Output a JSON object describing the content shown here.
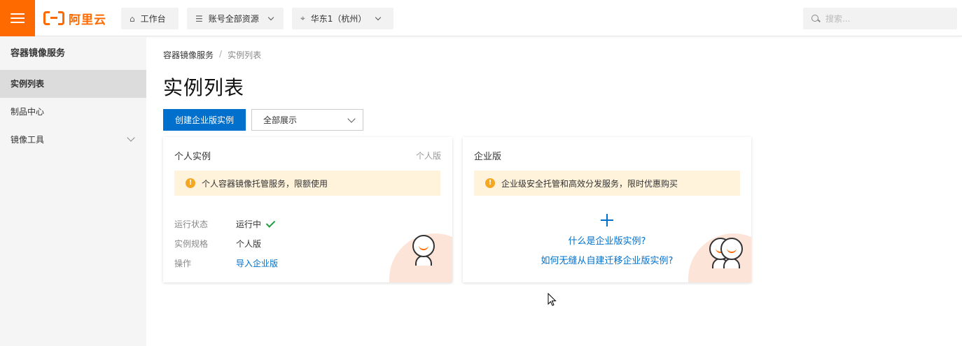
{
  "topbar": {
    "logo_text": "阿里云",
    "workbench_label": "工作台",
    "resources_label": "账号全部资源",
    "region_label": "华东1（杭州）",
    "search_placeholder": "搜索..."
  },
  "sidebar": {
    "title": "容器镜像服务",
    "items": [
      {
        "label": "实例列表",
        "active": true
      },
      {
        "label": "制品中心",
        "active": false
      },
      {
        "label": "镜像工具",
        "active": false
      }
    ]
  },
  "breadcrumb": {
    "root": "容器镜像服务",
    "separator": "/",
    "current": "实例列表"
  },
  "page": {
    "title": "实例列表",
    "create_button": "创建企业版实例",
    "filter_value": "全部展示"
  },
  "personal_card": {
    "title": "个人实例",
    "tag": "个人版",
    "notice": "个人容器镜像托管服务，限额使用",
    "rows": [
      {
        "key": "运行状态",
        "value": "运行中"
      },
      {
        "key": "实例规格",
        "value": "个人版"
      },
      {
        "key": "操作",
        "value": "导入企业版"
      }
    ]
  },
  "enterprise_card": {
    "title": "企业版",
    "notice": "企业级安全托管和高效分发服务，限时优惠购买",
    "link_what": "什么是企业版实例?",
    "link_migrate": "如何无缝从自建迁移企业版实例?"
  },
  "colors": {
    "brand": "#ff6a00",
    "primary": "#0070cc",
    "notice_bg": "#fff3db",
    "success": "#1e9e3e"
  }
}
